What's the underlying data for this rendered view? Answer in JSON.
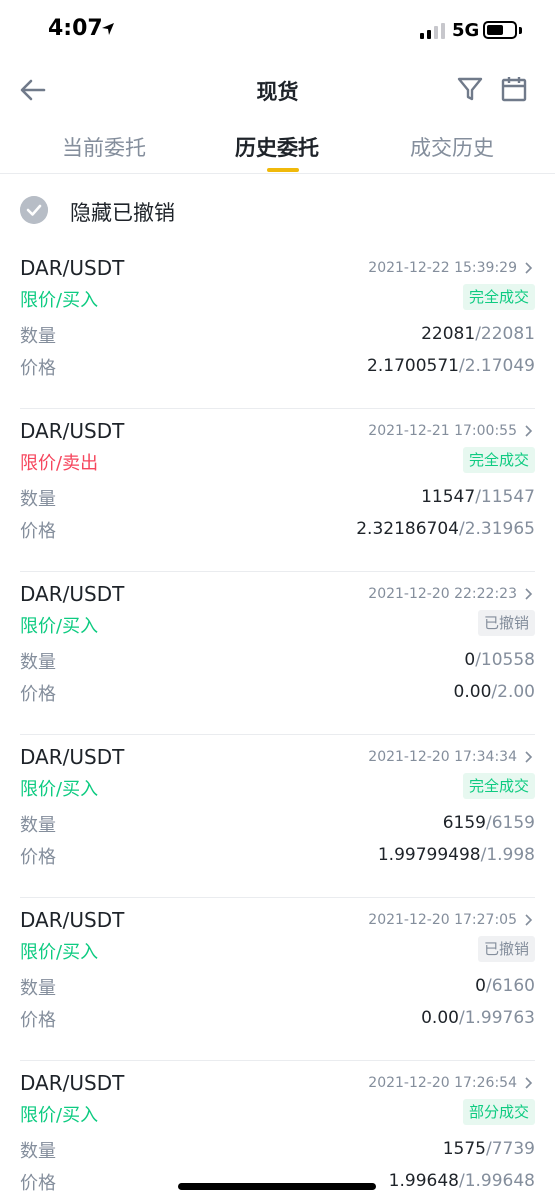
{
  "status_bar": {
    "time": "4:07",
    "network": "5G"
  },
  "nav": {
    "title": "现货"
  },
  "tabs": [
    {
      "label": "当前委托"
    },
    {
      "label": "历史委托"
    },
    {
      "label": "成交历史"
    }
  ],
  "filter": {
    "hide_cancelled_label": "隐藏已撤销"
  },
  "labels": {
    "quantity": "数量",
    "price": "价格"
  },
  "orders": [
    {
      "pair": "DAR/USDT",
      "time": "2021-12-22 15:39:29",
      "type": "限价/买入",
      "side": "buy",
      "status": "完全成交",
      "qty_filled": "22081",
      "qty_total": "/22081",
      "price_avg": "2.1700571",
      "price_order": "/2.17049"
    },
    {
      "pair": "DAR/USDT",
      "time": "2021-12-21 17:00:55",
      "type": "限价/卖出",
      "side": "sell",
      "status": "完全成交",
      "qty_filled": "11547",
      "qty_total": "/11547",
      "price_avg": "2.32186704",
      "price_order": "/2.31965"
    },
    {
      "pair": "DAR/USDT",
      "time": "2021-12-20 22:22:23",
      "type": "限价/买入",
      "side": "buy",
      "status": "已撤销",
      "qty_filled": "0",
      "qty_total": "/10558",
      "price_avg": "0.00",
      "price_order": "/2.00"
    },
    {
      "pair": "DAR/USDT",
      "time": "2021-12-20 17:34:34",
      "type": "限价/买入",
      "side": "buy",
      "status": "完全成交",
      "qty_filled": "6159",
      "qty_total": "/6159",
      "price_avg": "1.99799498",
      "price_order": "/1.998"
    },
    {
      "pair": "DAR/USDT",
      "time": "2021-12-20 17:27:05",
      "type": "限价/买入",
      "side": "buy",
      "status": "已撤销",
      "qty_filled": "0",
      "qty_total": "/6160",
      "price_avg": "0.00",
      "price_order": "/1.99763"
    },
    {
      "pair": "DAR/USDT",
      "time": "2021-12-20 17:26:54",
      "type": "限价/买入",
      "side": "buy",
      "status": "部分成交",
      "qty_filled": "1575",
      "qty_total": "/7739",
      "price_avg": "1.99648",
      "price_order": "/1.99648"
    }
  ],
  "colors": {
    "buy": "#0ecb81",
    "sell": "#f6465d",
    "accent": "#f0b90b",
    "muted": "#848e9c"
  }
}
